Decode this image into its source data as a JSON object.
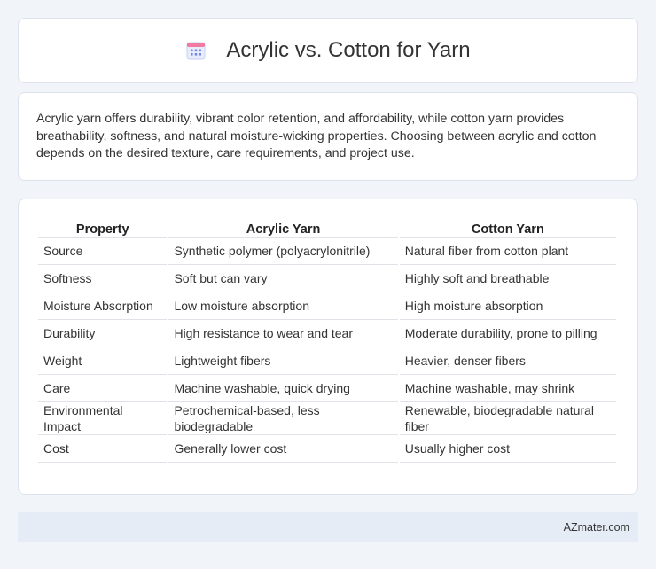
{
  "header": {
    "title": "Acrylic vs. Cotton for Yarn",
    "icon": "calendar-icon"
  },
  "intro": {
    "text": "Acrylic yarn offers durability, vibrant color retention, and affordability, while cotton yarn provides breathability, softness, and natural moisture-wicking properties. Choosing between acrylic and cotton depends on the desired texture, care requirements, and project use."
  },
  "table": {
    "headers": [
      "Property",
      "Acrylic Yarn",
      "Cotton Yarn"
    ],
    "rows": [
      [
        "Source",
        "Synthetic polymer (polyacrylonitrile)",
        "Natural fiber from cotton plant"
      ],
      [
        "Softness",
        "Soft but can vary",
        "Highly soft and breathable"
      ],
      [
        "Moisture Absorption",
        "Low moisture absorption",
        "High moisture absorption"
      ],
      [
        "Durability",
        "High resistance to wear and tear",
        "Moderate durability, prone to pilling"
      ],
      [
        "Weight",
        "Lightweight fibers",
        "Heavier, denser fibers"
      ],
      [
        "Care",
        "Machine washable, quick drying",
        "Machine washable, may shrink"
      ],
      [
        "Environmental Impact",
        "Petrochemical-based, less biodegradable",
        "Renewable, biodegradable natural fiber"
      ],
      [
        "Cost",
        "Generally lower cost",
        "Usually higher cost"
      ]
    ]
  },
  "footer": {
    "brand": "AZmater.com"
  },
  "colors": {
    "page_bg": "#f1f4f9",
    "footer_bg": "#e6ecf6",
    "icon_accent": "#6f8be8"
  }
}
